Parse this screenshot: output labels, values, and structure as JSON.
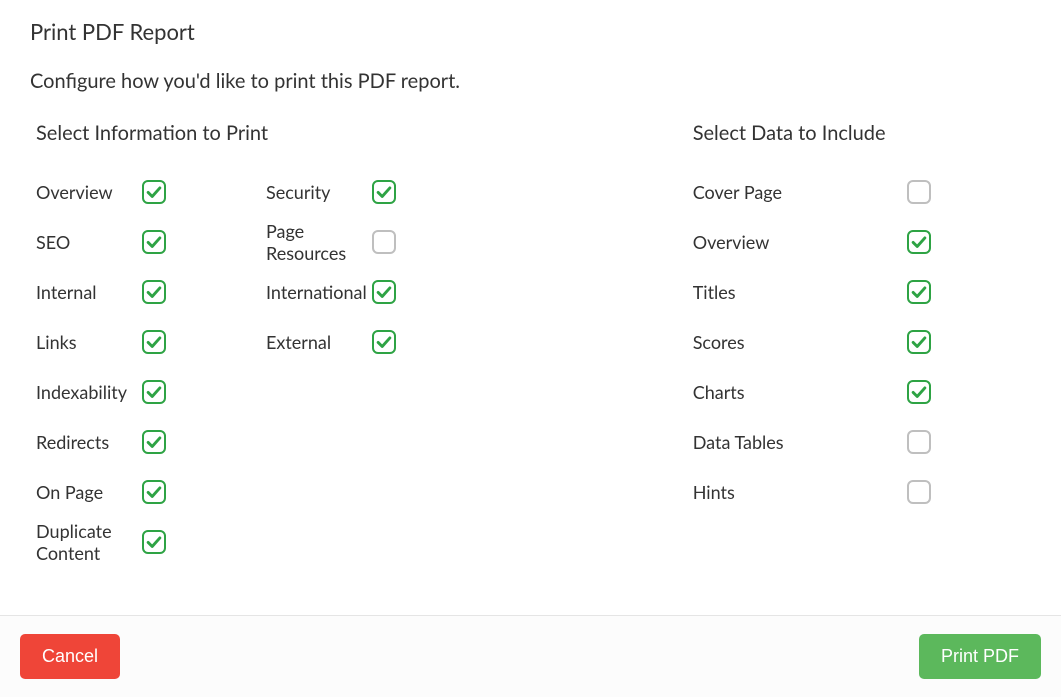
{
  "modal": {
    "title": "Print PDF Report",
    "subtitle": "Configure how you'd like to print this PDF report."
  },
  "sections": {
    "info": {
      "title": "Select Information to Print",
      "options_col1": [
        {
          "key": "overview",
          "label": "Overview",
          "checked": true
        },
        {
          "key": "seo",
          "label": "SEO",
          "checked": true
        },
        {
          "key": "internal",
          "label": "Internal",
          "checked": true
        },
        {
          "key": "links",
          "label": "Links",
          "checked": true
        },
        {
          "key": "indexability",
          "label": "Indexability",
          "checked": true
        },
        {
          "key": "redirects",
          "label": "Redirects",
          "checked": true
        },
        {
          "key": "on-page",
          "label": "On Page",
          "checked": true
        },
        {
          "key": "duplicate-content",
          "label": "Duplicate Content",
          "checked": true
        }
      ],
      "options_col2": [
        {
          "key": "security",
          "label": "Security",
          "checked": true
        },
        {
          "key": "page-resources",
          "label": "Page Resources",
          "checked": false
        },
        {
          "key": "international",
          "label": "International",
          "checked": true
        },
        {
          "key": "external",
          "label": "External",
          "checked": true
        }
      ]
    },
    "data": {
      "title": "Select Data to Include",
      "options": [
        {
          "key": "cover-page",
          "label": "Cover Page",
          "checked": false
        },
        {
          "key": "overview-data",
          "label": "Overview",
          "checked": true
        },
        {
          "key": "titles",
          "label": "Titles",
          "checked": true
        },
        {
          "key": "scores",
          "label": "Scores",
          "checked": true
        },
        {
          "key": "charts",
          "label": "Charts",
          "checked": true
        },
        {
          "key": "data-tables",
          "label": "Data Tables",
          "checked": false
        },
        {
          "key": "hints",
          "label": "Hints",
          "checked": false
        }
      ]
    }
  },
  "footer": {
    "cancel_label": "Cancel",
    "submit_label": "Print PDF"
  },
  "colors": {
    "accent": "#2ea344",
    "cancel": "#ef4538",
    "primary": "#5cb85c"
  }
}
